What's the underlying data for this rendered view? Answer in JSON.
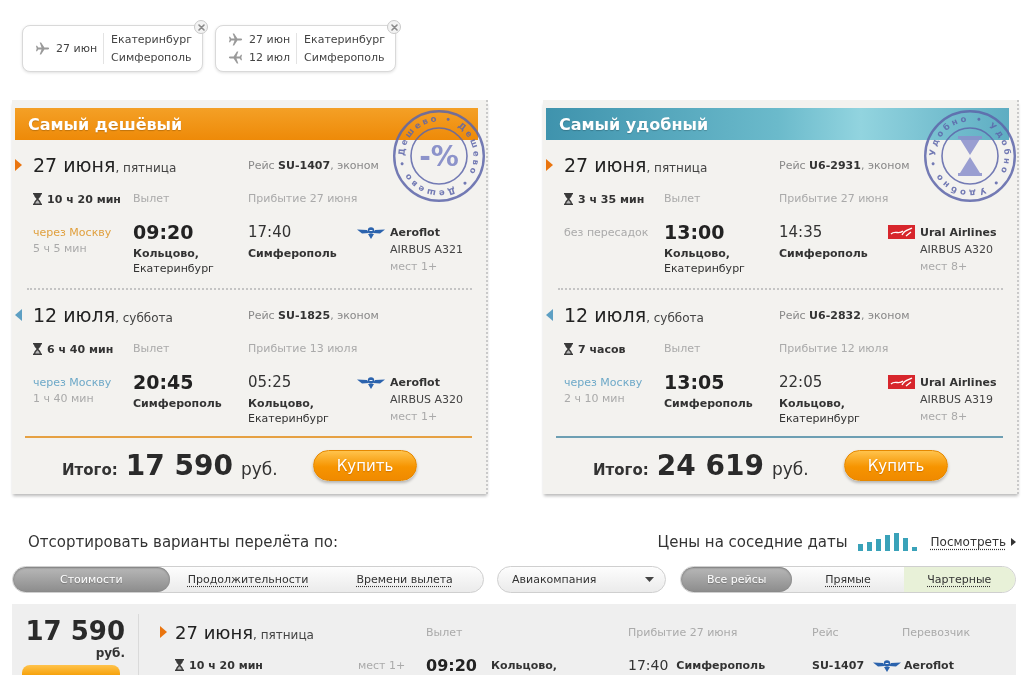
{
  "trip_chips": [
    {
      "legs": [
        {
          "kind": "outbound",
          "date": "27 июн"
        }
      ],
      "cities": [
        "Екатеринбург",
        "Симферополь"
      ]
    },
    {
      "legs": [
        {
          "kind": "outbound",
          "date": "27 июн"
        },
        {
          "kind": "return",
          "date": "12 июл"
        }
      ],
      "cities": [
        "Екатеринбург",
        "Симферополь"
      ]
    }
  ],
  "offers": [
    {
      "kind": "cheapest",
      "title": "Самый дешёвый",
      "stamp": {
        "kind": "percent",
        "ring_text": "Дешево • Дешево • Дешево •",
        "label": "-%"
      },
      "segments": [
        {
          "kind": "outbound",
          "date": "27 июня",
          "weekday": ", пятница",
          "flight": "Рейс **SU-1407**, эконом",
          "duration": "10 ч 20 мин",
          "departure_label": "Вылет",
          "arrival_label": "Прибытие 27 июня",
          "stop": {
            "kind": "transfer",
            "text": "через Москву",
            "duration": "5 ч 5 мин"
          },
          "departure": {
            "time": "09:20",
            "airport": "Кольцово,",
            "city": "Екатеринбург"
          },
          "arrival": {
            "time": "17:40",
            "airport": "Симферополь"
          },
          "airline": {
            "kind": "aeroflot",
            "name": "Aeroflot",
            "aircraft": "AIRBUS A321",
            "seats": "мест 1+"
          }
        },
        {
          "kind": "return",
          "date": "12 июля",
          "weekday": ", суббота",
          "flight": "Рейс **SU-1825**, эконом",
          "duration": "6 ч 40 мин",
          "departure_label": "Вылет",
          "arrival_label": "Прибытие 13 июля",
          "stop": {
            "kind": "transfer",
            "text": "через Москву",
            "duration": "1 ч 40 мин"
          },
          "departure": {
            "time": "20:45",
            "airport": "Симферополь"
          },
          "arrival": {
            "time": "05:25",
            "airport": "Кольцово,",
            "city": "Екатеринбург"
          },
          "airline": {
            "kind": "aeroflot",
            "name": "Aeroflot",
            "aircraft": "AIRBUS A320",
            "seats": "мест 1+"
          }
        }
      ],
      "total_label": "Итого:",
      "price": "17 590",
      "currency": "руб.",
      "buy_button": "Купить"
    },
    {
      "kind": "convenient",
      "title": "Самый удобный",
      "stamp": {
        "kind": "hourglass",
        "ring_text": "Удобно • Удобно • Удобно •"
      },
      "segments": [
        {
          "kind": "outbound",
          "date": "27 июня",
          "weekday": ", пятница",
          "flight": "Рейс **U6-2931**, эконом",
          "duration": "3 ч 35 мин",
          "departure_label": "Вылет",
          "arrival_label": "Прибытие 27 июня",
          "stop": {
            "kind": "direct",
            "text": "без пересадок"
          },
          "departure": {
            "time": "13:00",
            "airport": "Кольцово,",
            "city": "Екатеринбург"
          },
          "arrival": {
            "time": "14:35",
            "airport": "Симферополь"
          },
          "airline": {
            "kind": "ural",
            "name": "Ural Airlines",
            "aircraft": "AIRBUS A320",
            "seats": "мест 8+"
          }
        },
        {
          "kind": "return",
          "date": "12 июля",
          "weekday": ", суббота",
          "flight": "Рейс **U6-2832**, эконом",
          "duration": "7 часов",
          "departure_label": "Вылет",
          "arrival_label": "Прибытие 12 июля",
          "stop": {
            "kind": "transfer",
            "text": "через Москву",
            "duration": "2 ч 10 мин"
          },
          "departure": {
            "time": "13:05",
            "airport": "Симферополь"
          },
          "arrival": {
            "time": "22:05",
            "airport": "Кольцово,",
            "city": "Екатеринбург"
          },
          "airline": {
            "kind": "ural",
            "name": "Ural Airlines",
            "aircraft": "AIRBUS A319",
            "seats": "мест 8+"
          }
        }
      ],
      "total_label": "Итого:",
      "price": "24 619",
      "currency": "руб.",
      "buy_button": "Купить"
    }
  ],
  "sort": {
    "label": "Отсортировать варианты перелёта по:",
    "options": [
      {
        "label": "Стоимости",
        "selected": true
      },
      {
        "label": "Продолжительности",
        "selected": false
      },
      {
        "label": "Времени вылета",
        "selected": false
      }
    ]
  },
  "airline_filter": {
    "label": "Авиакомпания"
  },
  "neighbor_dates": {
    "label": "Цены на соседние даты",
    "link": "Посмотреть"
  },
  "flight_types": [
    {
      "label": "Все рейсы",
      "selected": true,
      "highlighted": false
    },
    {
      "label": "Прямые",
      "selected": false,
      "highlighted": false
    },
    {
      "label": "Чартерные",
      "selected": false,
      "highlighted": true
    }
  ],
  "results": [
    {
      "kind": "outbound",
      "price": "17 590",
      "currency": "руб.",
      "date": "27 июня",
      "weekday": ", пятница",
      "duration": "10 ч 20 мин",
      "seats": "мест 1+",
      "departure_label": "Вылет",
      "departure_time": "09:20",
      "departure_airport": "Кольцово,",
      "arrival_label": "Прибытие 27 июня",
      "arrival_time": "17:40",
      "arrival_airport": "Симферополь",
      "flight_label": "Рейс",
      "flight_number": "SU-1407",
      "carrier_label": "Перевозчик",
      "airline": {
        "kind": "aeroflot",
        "name": "Aeroflot"
      }
    }
  ]
}
